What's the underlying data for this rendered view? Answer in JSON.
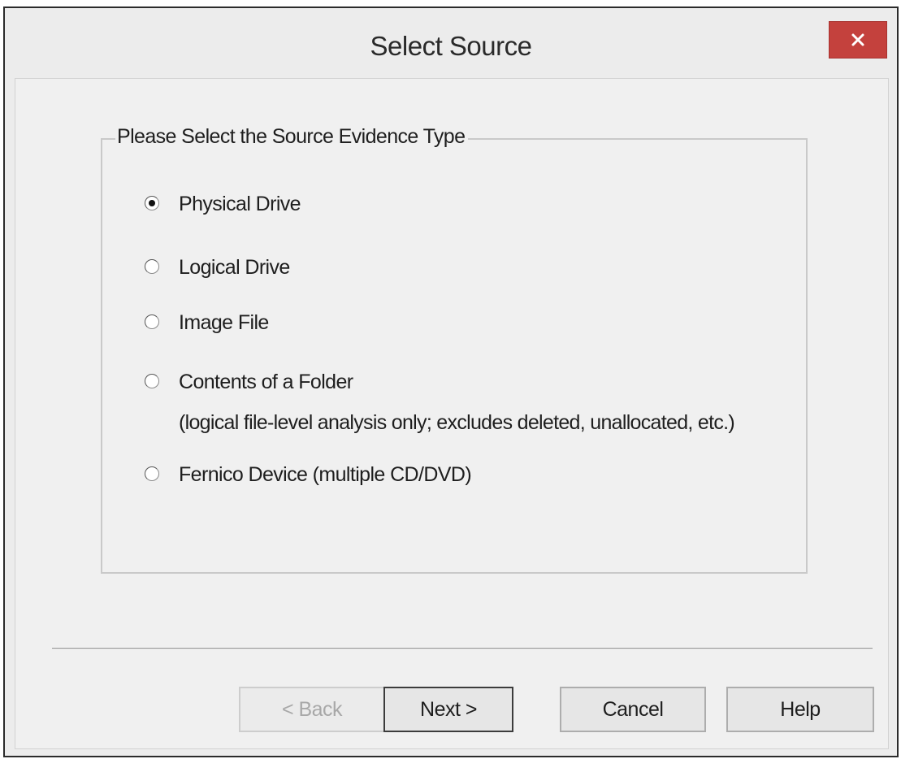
{
  "window": {
    "title": "Select Source",
    "close_label": "×"
  },
  "group": {
    "legend": "Please Select the Source Evidence Type",
    "options": [
      {
        "label": "Physical Drive",
        "checked": true
      },
      {
        "label": "Logical Drive",
        "checked": false
      },
      {
        "label": "Image File",
        "checked": false
      },
      {
        "label": "Contents of a Folder",
        "sublabel": "(logical file-level analysis only; excludes deleted, unallocated, etc.)",
        "checked": false
      },
      {
        "label": "Fernico Device (multiple CD/DVD)",
        "checked": false
      }
    ]
  },
  "buttons": {
    "back": "< Back",
    "next": "Next >",
    "cancel": "Cancel",
    "help": "Help"
  },
  "colors": {
    "close_button": "#c4413d",
    "dialog_background": "#f0f0f0"
  }
}
